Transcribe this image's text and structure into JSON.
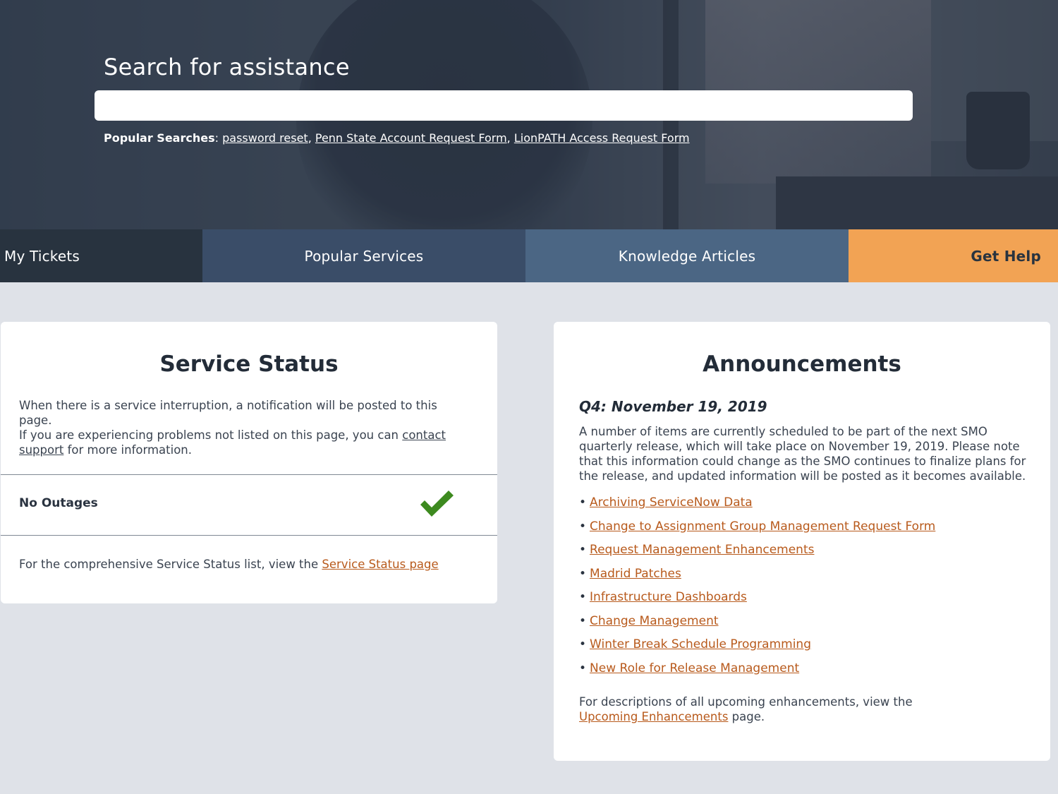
{
  "hero": {
    "title": "Search for assistance",
    "search_placeholder": "",
    "popular_label": "Popular Searches",
    "popular_searches": [
      "password reset",
      "Penn State Account Request Form",
      "LionPATH Access Request Form"
    ]
  },
  "tabs": [
    {
      "label": "My Tickets"
    },
    {
      "label": "Popular Services"
    },
    {
      "label": "Knowledge Articles"
    },
    {
      "label": "Get Help"
    }
  ],
  "service_status": {
    "title": "Service Status",
    "desc_line1": "When there is a service interruption, a notification will be posted to this page.",
    "desc_line2_pre": "If you are experiencing problems not listed on this page, you can ",
    "desc_link": "contact support",
    "desc_line2_post": " for more information.",
    "outage_label": "No Outages",
    "footer_pre": "For the comprehensive Service Status list, view the ",
    "footer_link": "Service Status page"
  },
  "announcements": {
    "title": "Announcements",
    "date_heading": "Q4: November 19, 2019",
    "body": "A number of items are currently scheduled to be part of the next SMO quarterly release, which will take place on November 19, 2019. Please note that this information could change as the SMO continues to finalize plans for the release, and updated information will be posted as it becomes available.",
    "items": [
      "Archiving ServiceNow Data",
      "Change to Assignment Group Management Request Form",
      "Request Management Enhancements",
      "Madrid Patches",
      "Infrastructure Dashboards",
      "Change Management",
      "Winter Break Schedule Programming",
      "New Role for Release Management"
    ],
    "footer_pre": "For descriptions of all upcoming enhancements, view the ",
    "footer_link": "Upcoming Enhancements",
    "footer_post": " page."
  },
  "colors": {
    "accent_orange": "#f2a354",
    "link_orange": "#b85a1c",
    "check_green": "#3d8a1f"
  }
}
